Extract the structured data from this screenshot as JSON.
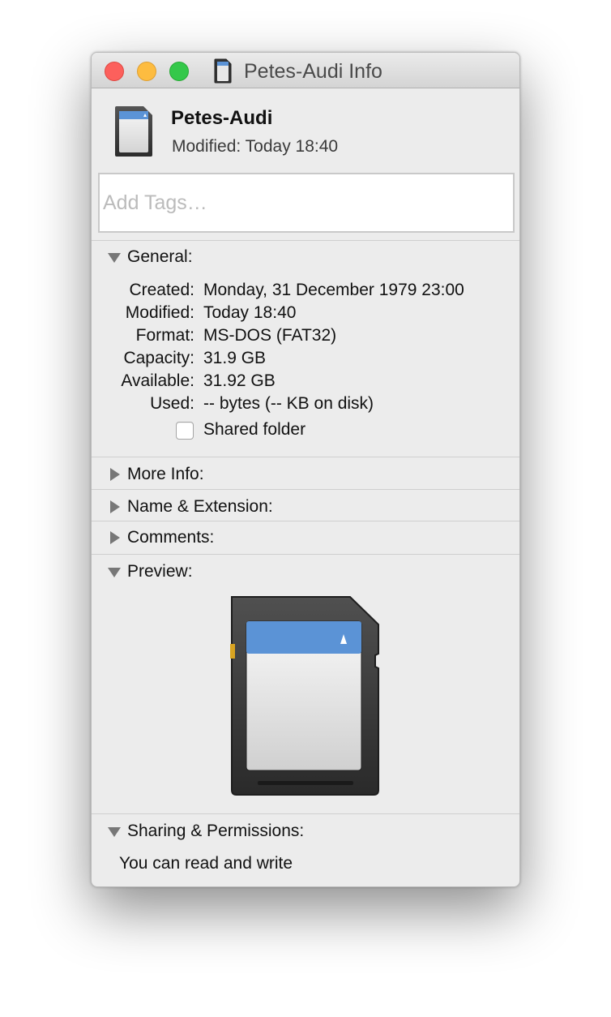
{
  "window": {
    "title": "Petes-Audi Info",
    "traffic_lights": {
      "close": "#fc605c",
      "minimize": "#fdbc40",
      "maximize": "#34c84a"
    }
  },
  "header": {
    "name": "Petes-Audi",
    "modified": "Modified: Today 18:40",
    "icon": "sd-card-icon"
  },
  "tags": {
    "placeholder": "Add Tags…",
    "value": ""
  },
  "general": {
    "label": "General:",
    "expanded": true,
    "rows": [
      {
        "label": "Created:",
        "value": "Monday, 31 December 1979 23:00"
      },
      {
        "label": "Modified:",
        "value": "Today 18:40"
      },
      {
        "label": "Format:",
        "value": "MS-DOS (FAT32)"
      },
      {
        "label": "Capacity:",
        "value": "31.9 GB"
      },
      {
        "label": "Available:",
        "value": "31.92 GB"
      },
      {
        "label": "Used:",
        "value": "-- bytes (-- KB on disk)"
      }
    ],
    "shared_folder": {
      "label": "Shared folder",
      "checked": false
    }
  },
  "more_info": {
    "label": "More Info:",
    "expanded": false
  },
  "name_extension": {
    "label": "Name & Extension:",
    "expanded": false
  },
  "comments": {
    "label": "Comments:",
    "expanded": false
  },
  "preview": {
    "label": "Preview:",
    "expanded": true,
    "image": "sd-card-icon"
  },
  "sharing": {
    "label": "Sharing & Permissions:",
    "expanded": true,
    "text": "You can read and write"
  },
  "colors": {
    "window_bg": "#ececec",
    "card_blue": "#5b93d6",
    "card_body": "#3a3a3a"
  }
}
